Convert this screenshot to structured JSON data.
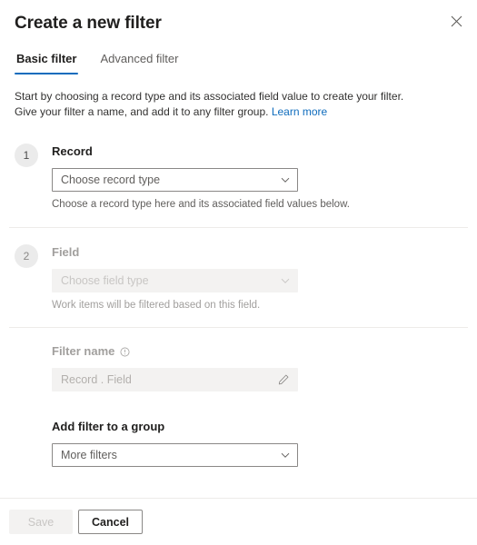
{
  "panel": {
    "title": "Create a new filter",
    "close_icon": "close-icon"
  },
  "tabs": [
    {
      "label": "Basic filter",
      "active": true
    },
    {
      "label": "Advanced filter",
      "active": false
    }
  ],
  "intro": {
    "text": "Start by choosing a record type and its associated field value to create your filter. Give your filter a name, and add it to any filter group.",
    "link_label": "Learn more"
  },
  "steps": [
    {
      "number": "1",
      "label": "Record",
      "dropdown_value": "Choose record type",
      "hint": "Choose a record type here and its associated field values below.",
      "disabled": false
    },
    {
      "number": "2",
      "label": "Field",
      "dropdown_value": "Choose field type",
      "hint": "Work items will be filtered based on this field.",
      "disabled": true
    }
  ],
  "filter_name": {
    "label": "Filter name",
    "info_icon": "info-circle-icon",
    "placeholder": "Record . Field",
    "edit_icon": "pencil-icon"
  },
  "filter_group": {
    "label": "Add filter to a group",
    "dropdown_value": "More filters"
  },
  "footer": {
    "save_label": "Save",
    "cancel_label": "Cancel"
  },
  "colors": {
    "accent": "#0f6cbd",
    "link": "#0f6cbd",
    "text_primary": "#201f1e",
    "text_secondary": "#605e5c",
    "text_disabled": "#a19f9d",
    "border": "#8a8886",
    "divider": "#edebe9",
    "disabled_bg": "#f3f2f1",
    "badge_bg": "#ebebeb"
  }
}
